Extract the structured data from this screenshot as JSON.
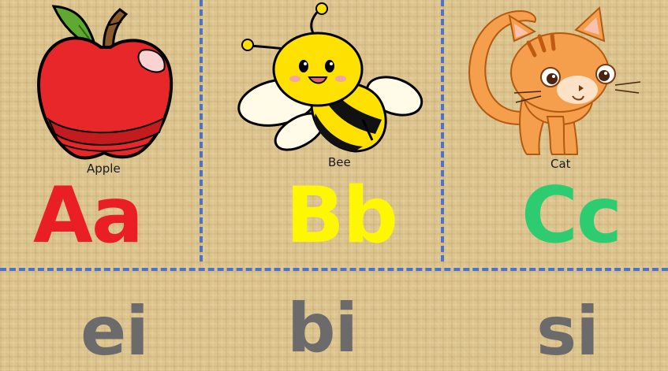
{
  "colors": {
    "apple_letter": "#ea1f25",
    "bee_letter": "#fdf701",
    "cat_letter": "#2ecc71",
    "sound": "#6b6b6b",
    "divider": "#4a74c9"
  },
  "cards": [
    {
      "word": "Apple",
      "letters": "Aa",
      "sound": "ei",
      "icon": "apple-icon"
    },
    {
      "word": "Bee",
      "letters": "Bb",
      "sound": "bi",
      "icon": "bee-icon"
    },
    {
      "word": "Cat",
      "letters": "Cc",
      "sound": "si",
      "icon": "cat-icon"
    }
  ]
}
